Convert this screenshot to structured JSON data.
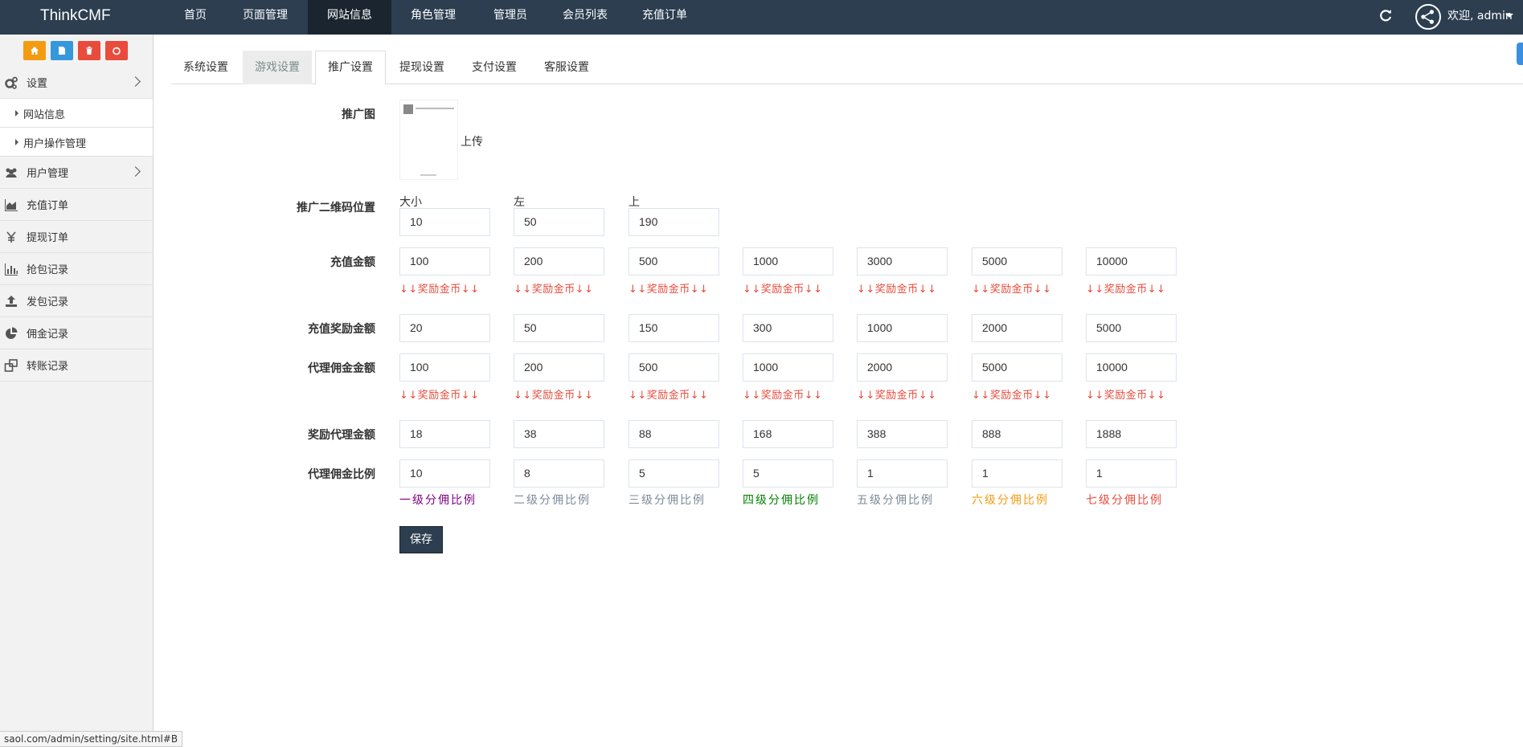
{
  "brand": "ThinkCMF",
  "topnav": [
    "首页",
    "页面管理",
    "网站信息",
    "角色管理",
    "管理员",
    "会员列表",
    "充值订单"
  ],
  "topnav_active": 2,
  "user": {
    "welcome": "欢迎, admin"
  },
  "shortcut_colors": [
    "#f39c12",
    "#3498db",
    "#e74c3c",
    "#e74c3c"
  ],
  "sidebar": {
    "settings": "设置",
    "sub_items": [
      "网站信息",
      "用户操作管理"
    ],
    "items": [
      {
        "label": "用户管理",
        "icon": "users-icon"
      },
      {
        "label": "充值订单",
        "icon": "area-chart-icon"
      },
      {
        "label": "提现订单",
        "icon": "yen-icon"
      },
      {
        "label": "抢包记录",
        "icon": "bar-chart-icon"
      },
      {
        "label": "发包记录",
        "icon": "upload-icon"
      },
      {
        "label": "佣金记录",
        "icon": "pie-chart-icon"
      },
      {
        "label": "转账记录",
        "icon": "transfer-icon"
      }
    ]
  },
  "tabs": [
    "系统设置",
    "游戏设置",
    "推广设置",
    "提现设置",
    "支付设置",
    "客服设置"
  ],
  "tab_active": 2,
  "form": {
    "promo_image_label": "推广图",
    "upload_label": "上传",
    "qr_position_label": "推广二维码位置",
    "qr_captions": [
      "大小",
      "左",
      "上"
    ],
    "qr_values": [
      "10",
      "50",
      "190"
    ],
    "recharge_label": "充值金额",
    "recharge_values": [
      "100",
      "200",
      "500",
      "1000",
      "3000",
      "5000",
      "10000"
    ],
    "reward_note": "↓↓奖励金币↓↓",
    "recharge_reward_label": "充值奖励金额",
    "recharge_reward_values": [
      "20",
      "50",
      "150",
      "300",
      "1000",
      "2000",
      "5000"
    ],
    "agent_amount_label": "代理佣金金额",
    "agent_amount_values": [
      "100",
      "200",
      "500",
      "1000",
      "2000",
      "5000",
      "10000"
    ],
    "agent_reward_label": "奖励代理金额",
    "agent_reward_values": [
      "18",
      "38",
      "88",
      "168",
      "388",
      "888",
      "1888"
    ],
    "ratio_label": "代理佣金比例",
    "ratio_values": [
      "10",
      "8",
      "5",
      "5",
      "1",
      "1",
      "1"
    ],
    "ratio_notes": [
      "一级分佣比例",
      "二级分佣比例",
      "三级分佣比例",
      "四级分佣比例",
      "五级分佣比例",
      "六级分佣比例",
      "七级分佣比例"
    ],
    "ratio_colors": [
      "#800080",
      "#7b8a9b",
      "#7b8a9b",
      "#008000",
      "#7b8a9b",
      "#f39c12",
      "#e74c3c"
    ],
    "save_label": "保存"
  },
  "status_url": "saol.com/admin/setting/site.html#B"
}
